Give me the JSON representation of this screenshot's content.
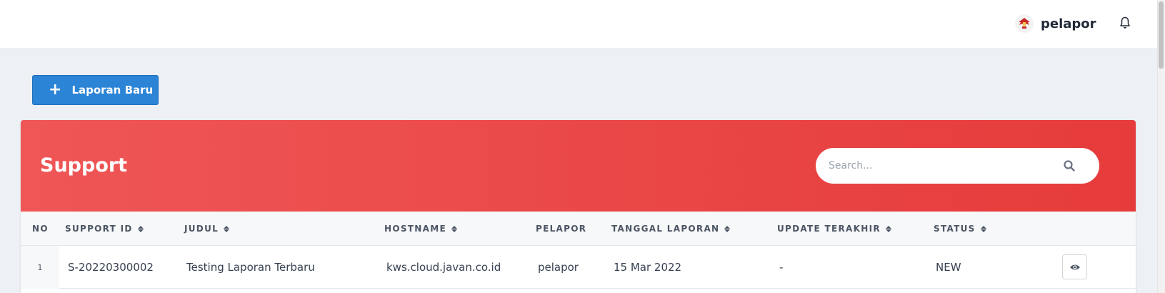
{
  "header": {
    "username": "pelapor",
    "avatar_icon": "garuda-logo-icon",
    "bell_icon": "bell-icon"
  },
  "actions": {
    "new_report_label": "Laporan Baru"
  },
  "card": {
    "title": "Support",
    "search_placeholder": "Search...",
    "header_color_start": "#ef5656",
    "header_color_end": "#e63b3b"
  },
  "table": {
    "columns": [
      "NO",
      "SUPPORT ID",
      "JUDUL",
      "HOSTNAME",
      "PELAPOR",
      "TANGGAL LAPORAN",
      "UPDATE TERAKHIR",
      "STATUS"
    ],
    "rows": [
      {
        "no": "1",
        "support_id": "S-20220300002",
        "judul": "Testing Laporan Terbaru",
        "hostname": "kws.cloud.javan.co.id",
        "pelapor": "pelapor",
        "tanggal_laporan": "15 Mar 2022",
        "update_terakhir": "-",
        "status": "NEW"
      }
    ]
  },
  "colors": {
    "primary_button": "#2b84d6",
    "page_background": "#edf1f5"
  }
}
